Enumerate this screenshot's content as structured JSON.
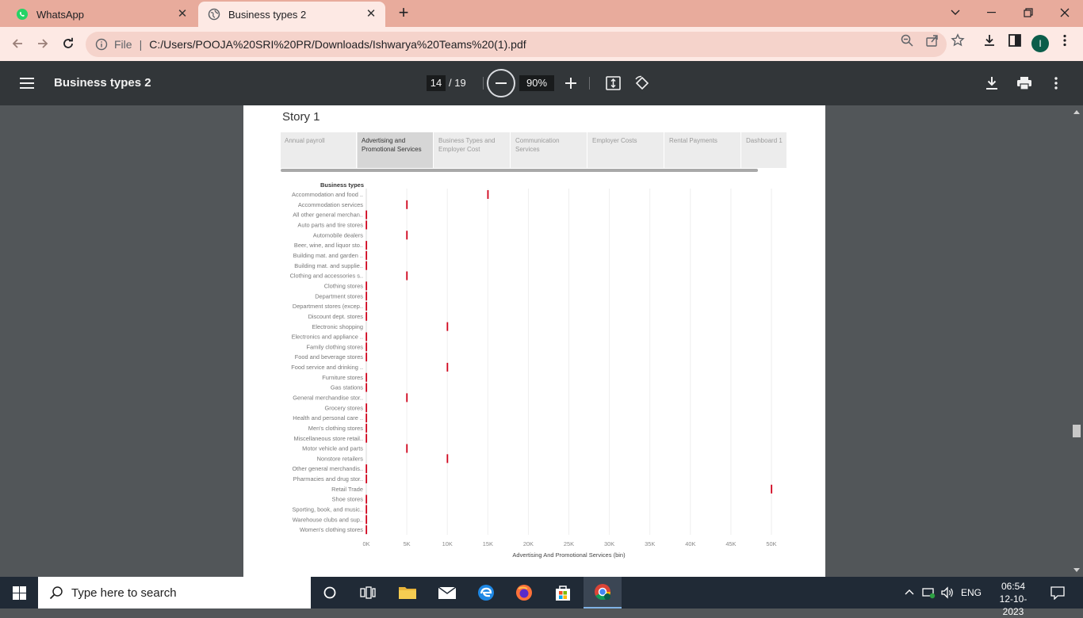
{
  "browser": {
    "tabs": [
      {
        "title": "WhatsApp",
        "active": false
      },
      {
        "title": "Business types 2",
        "active": true
      }
    ],
    "url_scheme": "File",
    "url": "C:/Users/POOJA%20SRI%20PR/Downloads/Ishwarya%20Teams%20(1).pdf",
    "profile_initial": "I"
  },
  "pdf_viewer": {
    "doc_title": "Business types 2",
    "page_current": "14",
    "page_total": "/ 19",
    "zoom": "90%"
  },
  "page": {
    "story_title": "Story 1",
    "story_tabs": [
      {
        "label": "Annual payroll",
        "selected": false
      },
      {
        "label": "Advertising and Promotional Services",
        "selected": true
      },
      {
        "label": "Business Types and Employer Cost",
        "selected": false
      },
      {
        "label": "Communication Services",
        "selected": false
      },
      {
        "label": "Employer Costs",
        "selected": false
      },
      {
        "label": "Rental Payments",
        "selected": false
      },
      {
        "label": "Dashboard 1",
        "selected": false
      }
    ],
    "axis_header": "Business types"
  },
  "chart_data": {
    "type": "scatter",
    "mark": "tick",
    "mark_color": "#d0021b",
    "xlabel": "Advertising And Promotional Services (bin)",
    "ylabel": "Business types",
    "x_ticks": [
      "0K",
      "5K",
      "10K",
      "15K",
      "20K",
      "25K",
      "30K",
      "35K",
      "40K",
      "45K",
      "50K"
    ],
    "xlim": [
      0,
      50000
    ],
    "grid": "vertical",
    "categories": [
      "Accommodation and food ..",
      "Accommodation services",
      "All other general merchan..",
      "Auto parts and tire stores",
      "Automobile dealers",
      "Beer, wine, and liquor sto..",
      "Building mat. and garden ..",
      "Building mat. and supplie..",
      "Clothing and accessories s..",
      "Clothing stores",
      "Department stores",
      "Department stores (excep..",
      "Discount dept. stores",
      "Electronic shopping",
      "Electronics and appliance ..",
      "Family clothing stores",
      "Food and beverage stores",
      "Food service and drinking ..",
      "Furniture stores",
      "Gas stations",
      "General merchandise stor..",
      "Grocery stores",
      "Health and personal care ..",
      "Men's clothing stores",
      "Miscellaneous store retail..",
      "Motor vehicle and parts",
      "Nonstore retailers",
      "Other general merchandis..",
      "Pharmacies and drug stor..",
      "Retail Trade",
      "Shoe stores",
      "Sporting, book, and music..",
      "Warehouse clubs and sup..",
      "Women's clothing stores"
    ],
    "values": [
      15000,
      5000,
      0,
      0,
      5000,
      0,
      0,
      0,
      5000,
      0,
      0,
      0,
      0,
      10000,
      0,
      0,
      0,
      10000,
      0,
      0,
      5000,
      0,
      0,
      0,
      0,
      5000,
      10000,
      0,
      0,
      50000,
      0,
      0,
      0,
      0
    ]
  },
  "taskbar": {
    "search_placeholder": "Type here to search",
    "language": "ENG",
    "time": "06:54",
    "date": "12-10-2023"
  }
}
